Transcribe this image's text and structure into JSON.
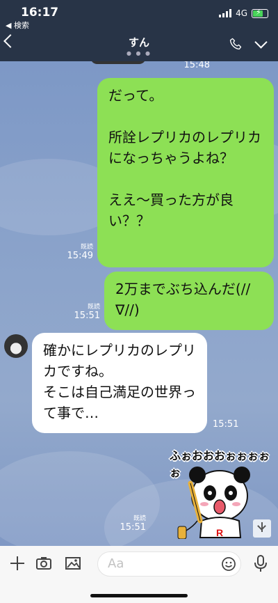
{
  "status": {
    "time": "16:17",
    "back_app": "◀ 検索",
    "network": "4G"
  },
  "header": {
    "title": "すん",
    "page_dots": "● ● ●"
  },
  "messages": [
    {
      "side": "right",
      "time": "15:48"
    },
    {
      "side": "right",
      "text": "だって。\n\n所詮レプリカのレプリカになっちゃうよね？\n\nええ〜買った方が良い？？",
      "read": "既読",
      "time": "15:49"
    },
    {
      "side": "right",
      "text": "2万までぶち込んだ(//∇//)",
      "read": "既読",
      "time": "15:51"
    },
    {
      "side": "left",
      "text": "確かにレプリカのレプリカですね。\nそこは自己満足の世界って事で…",
      "time": "15:51"
    },
    {
      "side": "right",
      "type": "sticker",
      "sticker_text": "ふぉおおおぉぉぉぉぉ",
      "badge": "R",
      "read": "既読",
      "time": "15:51"
    }
  ],
  "input": {
    "placeholder": "Aa"
  },
  "icons": [
    "back-icon",
    "phone-icon",
    "chevron-down-icon",
    "plus-icon",
    "camera-icon",
    "image-icon",
    "emoji-icon",
    "mic-icon"
  ]
}
